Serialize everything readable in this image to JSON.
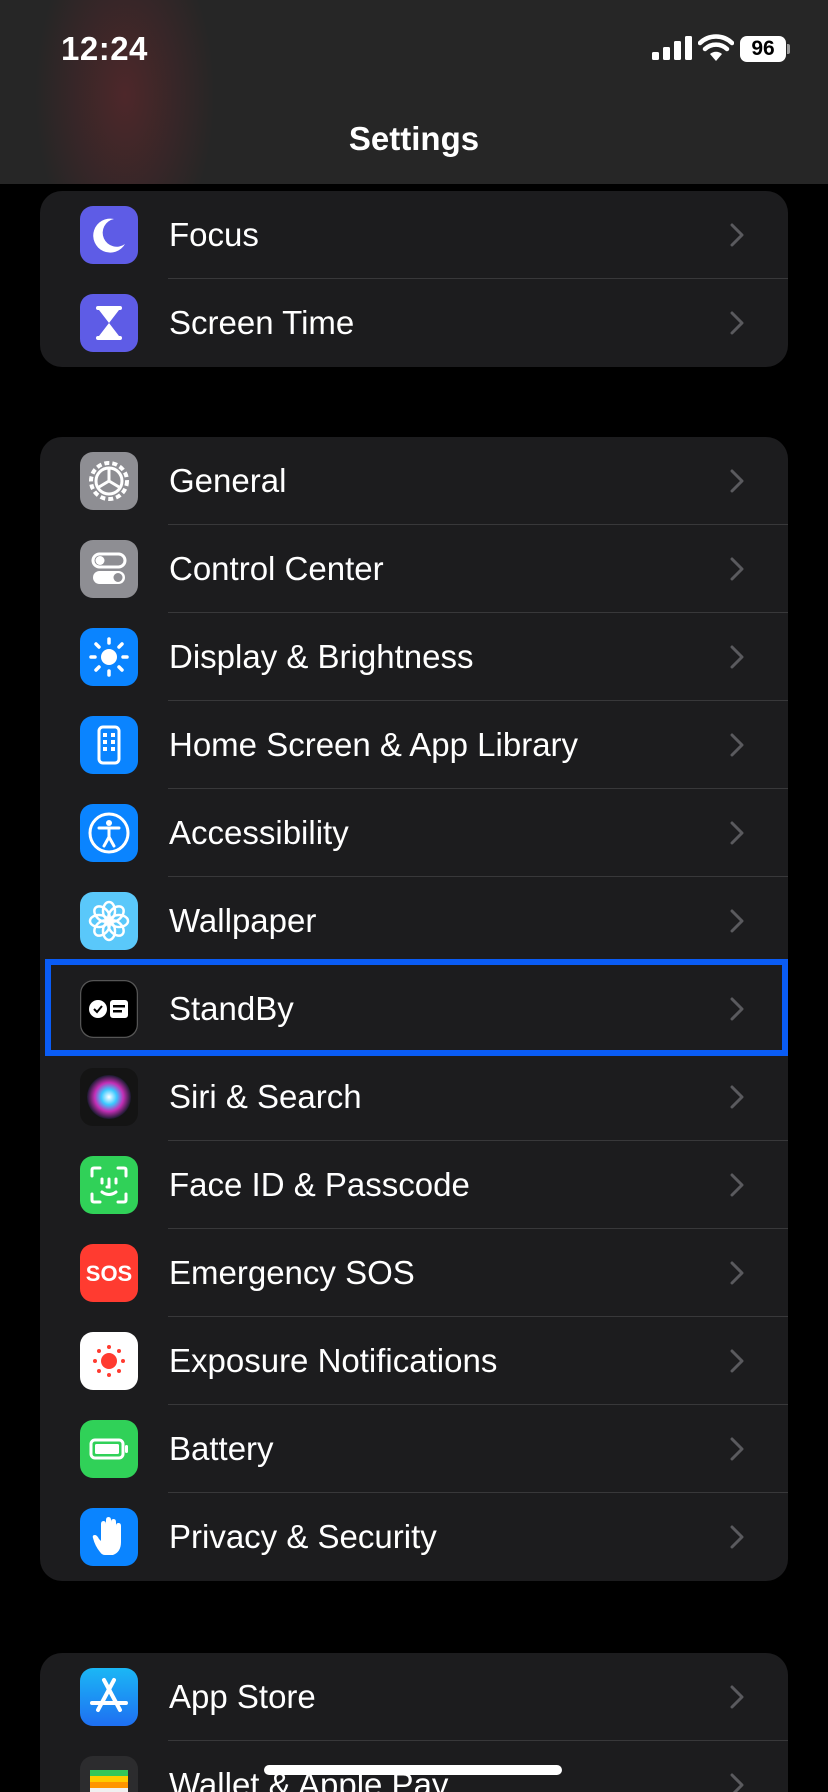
{
  "status_bar": {
    "time": "12:24",
    "battery_percent": "96"
  },
  "nav": {
    "title": "Settings"
  },
  "groups": [
    {
      "items": [
        {
          "label": "Focus",
          "icon": "focus-moon-icon",
          "color": "#5e5ce6"
        },
        {
          "label": "Screen Time",
          "icon": "screen-time-hourglass-icon",
          "color": "#5e5ce6"
        }
      ]
    },
    {
      "items": [
        {
          "label": "General",
          "icon": "general-gear-icon",
          "color": "#8e8e93"
        },
        {
          "label": "Control Center",
          "icon": "control-center-toggles-icon",
          "color": "#8e8e93"
        },
        {
          "label": "Display & Brightness",
          "icon": "display-sun-icon",
          "color": "#0a84ff"
        },
        {
          "label": "Home Screen & App Library",
          "icon": "home-screen-phone-icon",
          "color": "#0a84ff"
        },
        {
          "label": "Accessibility",
          "icon": "accessibility-person-icon",
          "color": "#0a84ff"
        },
        {
          "label": "Wallpaper",
          "icon": "wallpaper-flower-icon",
          "color": "#5ac8fa"
        },
        {
          "label": "StandBy",
          "icon": "standby-clock-icon",
          "color": "#000000",
          "highlighted": true
        },
        {
          "label": "Siri & Search",
          "icon": "siri-orb-icon",
          "color": "#1c1c1e"
        },
        {
          "label": "Face ID & Passcode",
          "icon": "face-id-icon",
          "color": "#30d158"
        },
        {
          "label": "Emergency SOS",
          "icon": "emergency-sos-icon",
          "color": "#ff3b30",
          "icon_text": "SOS"
        },
        {
          "label": "Exposure Notifications",
          "icon": "exposure-notifications-icon",
          "color": "#ffffff"
        },
        {
          "label": "Battery",
          "icon": "battery-icon",
          "color": "#30d158"
        },
        {
          "label": "Privacy & Security",
          "icon": "privacy-hand-icon",
          "color": "#0a84ff"
        }
      ]
    },
    {
      "items": [
        {
          "label": "App Store",
          "icon": "app-store-icon",
          "color": "#0a84ff"
        },
        {
          "label": "Wallet & Apple Pay",
          "icon": "wallet-icon",
          "color": "#1c1c1e"
        }
      ]
    }
  ],
  "colors": {
    "highlight": "#0a5cf5",
    "accent": "#0a84ff"
  }
}
